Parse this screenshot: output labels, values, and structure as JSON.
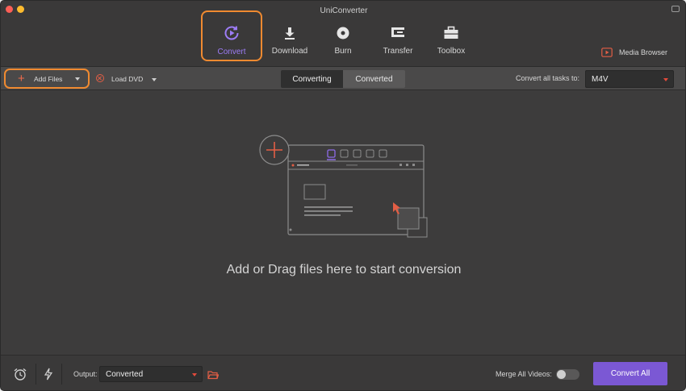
{
  "window": {
    "title": "UniConverter"
  },
  "nav": {
    "tabs": [
      {
        "label": "Convert",
        "icon": "convert-icon",
        "active": true
      },
      {
        "label": "Download",
        "icon": "download-icon",
        "active": false
      },
      {
        "label": "Burn",
        "icon": "disc-icon",
        "active": false
      },
      {
        "label": "Transfer",
        "icon": "transfer-icon",
        "active": false
      },
      {
        "label": "Toolbox",
        "icon": "toolbox-icon",
        "active": false
      }
    ],
    "media_browser": {
      "label": "Media Browser",
      "icon": "media-browser-icon"
    }
  },
  "toolbar": {
    "add_files": "Add Files",
    "load_dvd": "Load DVD",
    "segments": [
      "Converting",
      "Converted"
    ],
    "active_segment": "Converting",
    "convert_all_label": "Convert all tasks to:",
    "format_value": "M4V"
  },
  "main": {
    "drop_text": "Add or Drag files here to start conversion"
  },
  "bottom": {
    "output_label": "Output:",
    "output_value": "Converted",
    "merge_label": "Merge All Videos:",
    "merge_enabled": false,
    "convert_all_button": "Convert All"
  },
  "colors": {
    "accent_purple": "#7b58d4",
    "highlight_orange": "#f08a30",
    "active_tab_text": "#9d7cf6",
    "icon_red": "#e24a3b"
  }
}
